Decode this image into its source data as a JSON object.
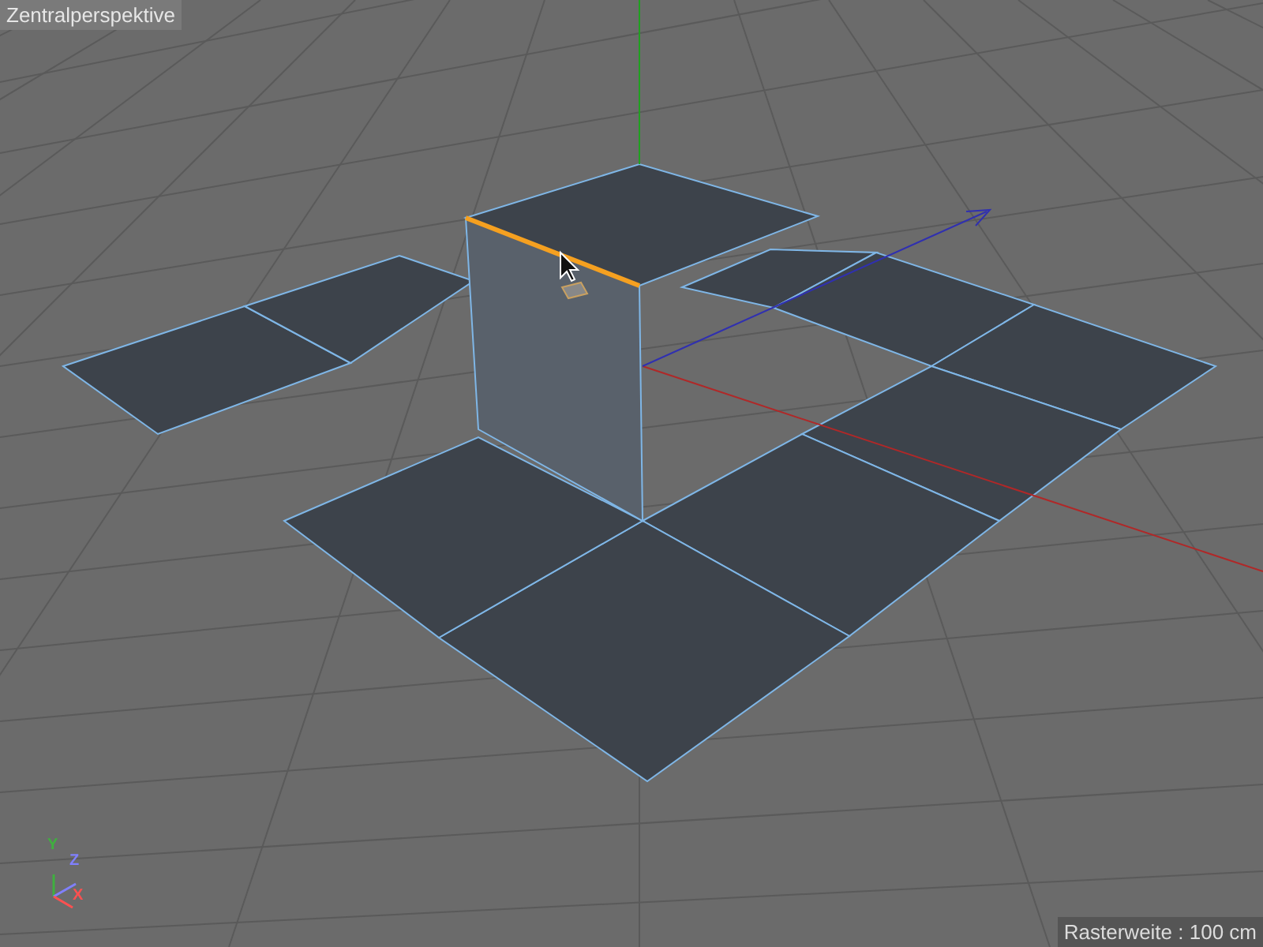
{
  "viewport": {
    "title": "Zentralperspektive"
  },
  "axis_gizmo": {
    "axes": [
      {
        "label": "Y",
        "color": "#3fb03f"
      },
      {
        "label": "Z",
        "color": "#8080ff"
      },
      {
        "label": "X",
        "color": "#ff5050"
      }
    ]
  },
  "status": {
    "grid_spacing": "Rasterweite : 100 cm"
  }
}
